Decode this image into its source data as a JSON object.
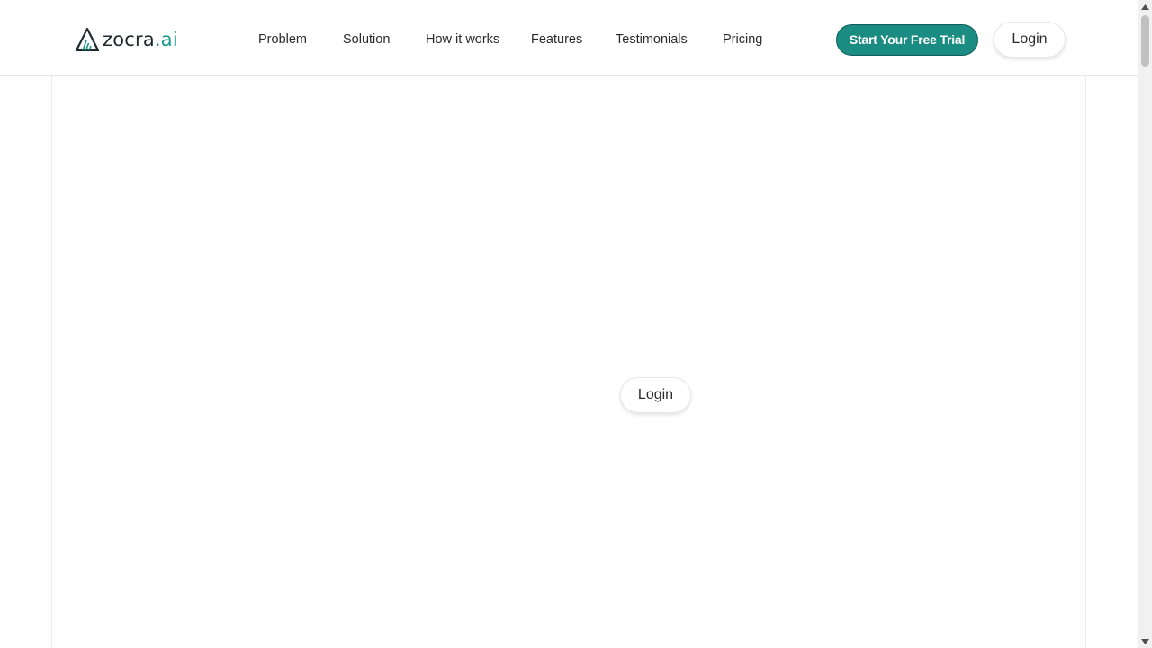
{
  "brand": {
    "name_main": "zocra",
    "name_accent": ".ai",
    "logo_icon": "triangle-chart-logo-icon",
    "accent_color": "#1a9a8c",
    "dark_color": "#1f2a2e"
  },
  "nav": {
    "items": [
      {
        "label": "Problem"
      },
      {
        "label": "Solution"
      },
      {
        "label": "How it works"
      },
      {
        "label": "Features"
      },
      {
        "label": "Testimonials"
      },
      {
        "label": "Pricing"
      }
    ]
  },
  "header_actions": {
    "cta_label": "Start Your Free Trial",
    "cta_color": "#1a8c81",
    "login_label": "Login"
  },
  "main": {
    "login_label": "Login"
  },
  "scrollbar": {
    "up_icon": "scroll-up-arrow-icon",
    "down_icon": "scroll-down-arrow-icon"
  }
}
